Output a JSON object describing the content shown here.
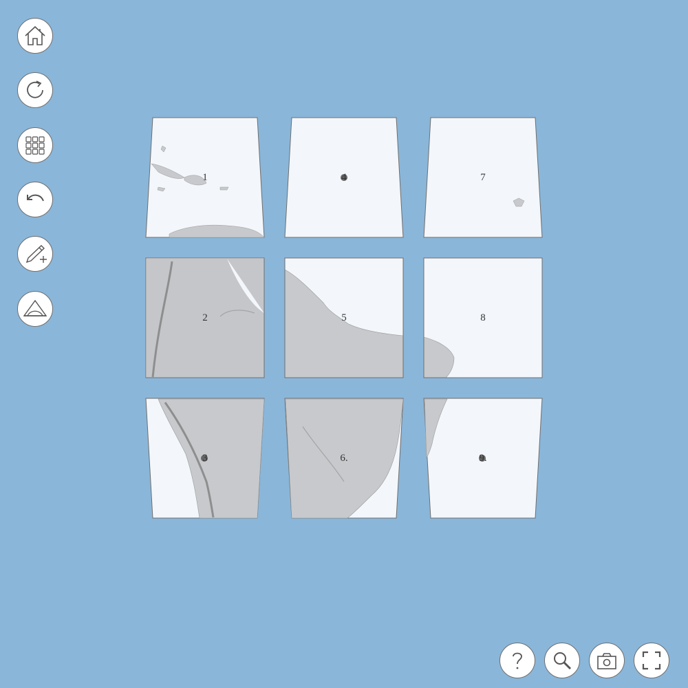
{
  "colors": {
    "background": "#8ab6d9",
    "sheet_fill": "#f3f6fa",
    "land_fill": "#c7c9cc",
    "sheet_border": "#6e6e6e",
    "button_border": "#6e6e6e"
  },
  "toolbar_left": [
    {
      "name": "home-button",
      "icon": "home-icon"
    },
    {
      "name": "rotate-button",
      "icon": "rotate-icon"
    },
    {
      "name": "grid-button",
      "icon": "grid-icon"
    },
    {
      "name": "undo-button",
      "icon": "undo-icon"
    },
    {
      "name": "add-pencil-button",
      "icon": "pencil-plus-icon"
    },
    {
      "name": "projection-button",
      "icon": "projection-icon"
    }
  ],
  "toolbar_bottom": [
    {
      "name": "help-button",
      "icon": "question-icon"
    },
    {
      "name": "search-button",
      "icon": "magnifier-icon"
    },
    {
      "name": "screenshot-button",
      "icon": "camera-icon"
    },
    {
      "name": "fullscreen-button",
      "icon": "fullscreen-icon"
    }
  ],
  "sheets": [
    {
      "id": "sheet-1",
      "label": "1"
    },
    {
      "id": "sheet-2",
      "label": "2"
    },
    {
      "id": "sheet-3",
      "label": "3"
    },
    {
      "id": "sheet-4",
      "label": "4"
    },
    {
      "id": "sheet-5",
      "label": "5"
    },
    {
      "id": "sheet-6",
      "label": "6."
    },
    {
      "id": "sheet-7",
      "label": "7"
    },
    {
      "id": "sheet-8",
      "label": "8"
    },
    {
      "id": "sheet-9",
      "label": "9."
    }
  ]
}
